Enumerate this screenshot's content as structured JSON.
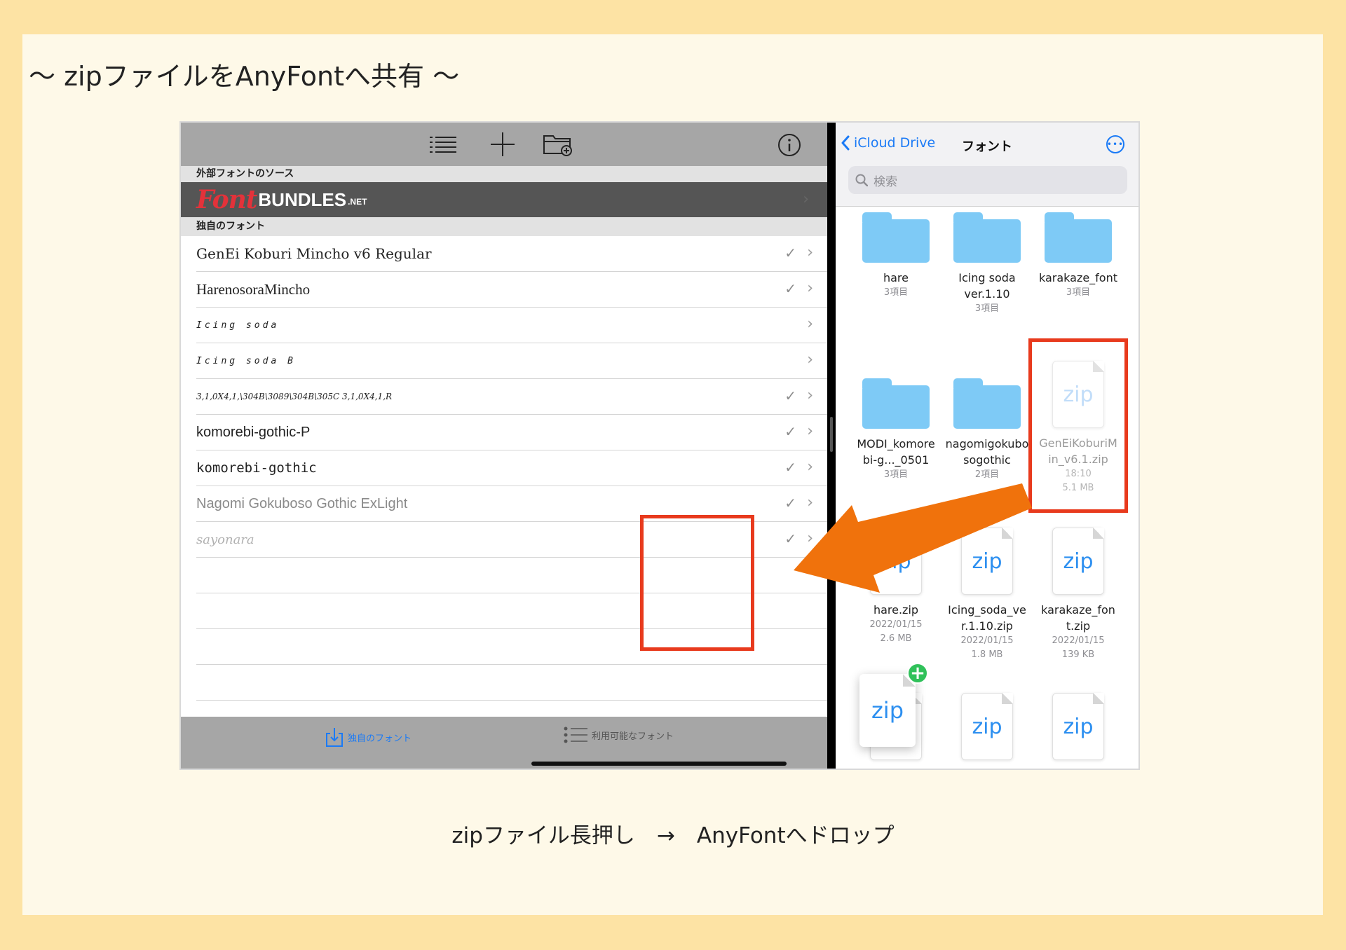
{
  "title": "〜 zipファイルをAnyFontへ共有 〜",
  "caption": "zipファイル長押し　→　AnyFontへドロップ",
  "left_app": {
    "toolbar_icons": [
      "list-icon",
      "plus-icon",
      "folder-add-icon",
      "info-icon"
    ],
    "external_section": "外部フォントのソース",
    "banner": {
      "font": "Font",
      "bundles": "BUNDLES",
      "net": ".NET"
    },
    "own_section": "独自のフォント",
    "fonts": [
      {
        "name": "GenEi Koburi Mincho v6 Regular",
        "checked": true
      },
      {
        "name": "HarenosoraMincho",
        "checked": true
      },
      {
        "name": "Icing soda",
        "checked": false
      },
      {
        "name": "Icing soda B",
        "checked": false
      },
      {
        "name": "3,1,0X4,1,\\304B\\3089\\304B\\305C 3,1,0X4,1,R",
        "checked": true
      },
      {
        "name": "komorebi-gothic-P",
        "checked": true
      },
      {
        "name": "komorebi-gothic",
        "checked": true
      },
      {
        "name": "Nagomi Gokuboso Gothic ExLight",
        "checked": true
      },
      {
        "name": "sayonara",
        "checked": true
      }
    ],
    "tabs": {
      "own": "独自のフォント",
      "available": "利用可能なフォント"
    },
    "drag_file": "zip"
  },
  "right_app": {
    "back_label": "iCloud Drive",
    "title": "フォント",
    "search_placeholder": "検索",
    "items": [
      {
        "kind": "folder",
        "name": "hare",
        "meta1": "3項目",
        "meta2": ""
      },
      {
        "kind": "folder",
        "name": "Icing soda ver.1.10",
        "meta1": "3項目",
        "meta2": ""
      },
      {
        "kind": "folder",
        "name": "karakaze_font",
        "meta1": "3項目",
        "meta2": ""
      },
      {
        "kind": "folder",
        "name": "MODI_komorebi-g..._0501",
        "meta1": "3項目",
        "meta2": ""
      },
      {
        "kind": "folder",
        "name": "nagomigokubosogothic",
        "meta1": "2項目",
        "meta2": ""
      },
      {
        "kind": "zip",
        "name": "GenEiKoburiMin_v6.1.zip",
        "meta1": "18:10",
        "meta2": "5.1 MB",
        "dragging": true
      },
      {
        "kind": "zip",
        "name": "hare.zip",
        "meta1": "2022/01/15",
        "meta2": "2.6 MB"
      },
      {
        "kind": "zip",
        "name": "Icing_soda_ver.1.10.zip",
        "meta1": "2022/01/15",
        "meta2": "1.8 MB"
      },
      {
        "kind": "zip",
        "name": "karakaze_font.zip",
        "meta1": "2022/01/15",
        "meta2": "139 KB"
      },
      {
        "kind": "zip",
        "name": "",
        "meta1": "",
        "meta2": ""
      },
      {
        "kind": "zip",
        "name": "",
        "meta1": "",
        "meta2": ""
      },
      {
        "kind": "zip",
        "name": "",
        "meta1": "",
        "meta2": ""
      }
    ],
    "zip_label": "zip"
  },
  "colors": {
    "highlight": "#e83a1d",
    "arrow": "#f0720c",
    "link": "#1a7af6",
    "folder": "#7ecaf6",
    "background": "#fde3a4",
    "card": "#fef9e8"
  }
}
